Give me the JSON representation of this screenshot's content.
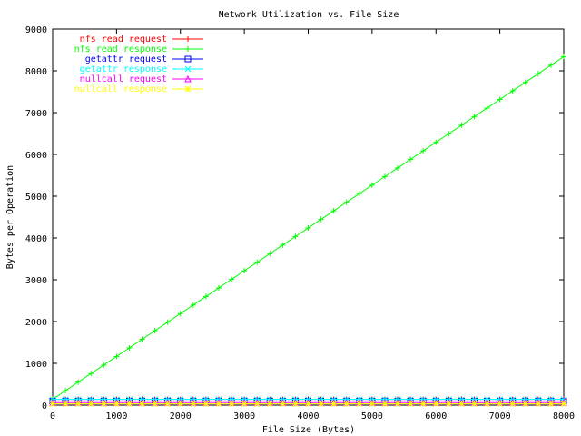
{
  "chart_data": {
    "type": "line",
    "title": "Network Utilization vs. File Size",
    "xlabel": "File Size (Bytes)",
    "ylabel": "Bytes per Operation",
    "xlim": [
      0,
      8000
    ],
    "ylim": [
      0,
      9000
    ],
    "xticks": [
      0,
      1000,
      2000,
      3000,
      4000,
      5000,
      6000,
      7000,
      8000
    ],
    "yticks": [
      0,
      1000,
      2000,
      3000,
      4000,
      5000,
      6000,
      7000,
      8000,
      9000
    ],
    "grid": false,
    "legend_position": "top-left",
    "x": {
      "start": 0,
      "end": 8000,
      "step": 200
    },
    "series": [
      {
        "name": "nfs read request",
        "color": "#ff0000",
        "marker": "plus",
        "y_start": 140,
        "y_end": 140
      },
      {
        "name": "nfs read response",
        "color": "#00ff00",
        "marker": "plus",
        "y_start": 140,
        "y_end": 8340
      },
      {
        "name": "getattr request",
        "color": "#0000ff",
        "marker": "square",
        "y_start": 100,
        "y_end": 100
      },
      {
        "name": "getattr response",
        "color": "#00ffff",
        "marker": "x",
        "y_start": 140,
        "y_end": 140
      },
      {
        "name": "nullcall request",
        "color": "#ff00ff",
        "marker": "triangle",
        "y_start": 60,
        "y_end": 60
      },
      {
        "name": "nullcall response",
        "color": "#ffff00",
        "marker": "star",
        "y_start": 30,
        "y_end": 30
      }
    ]
  }
}
